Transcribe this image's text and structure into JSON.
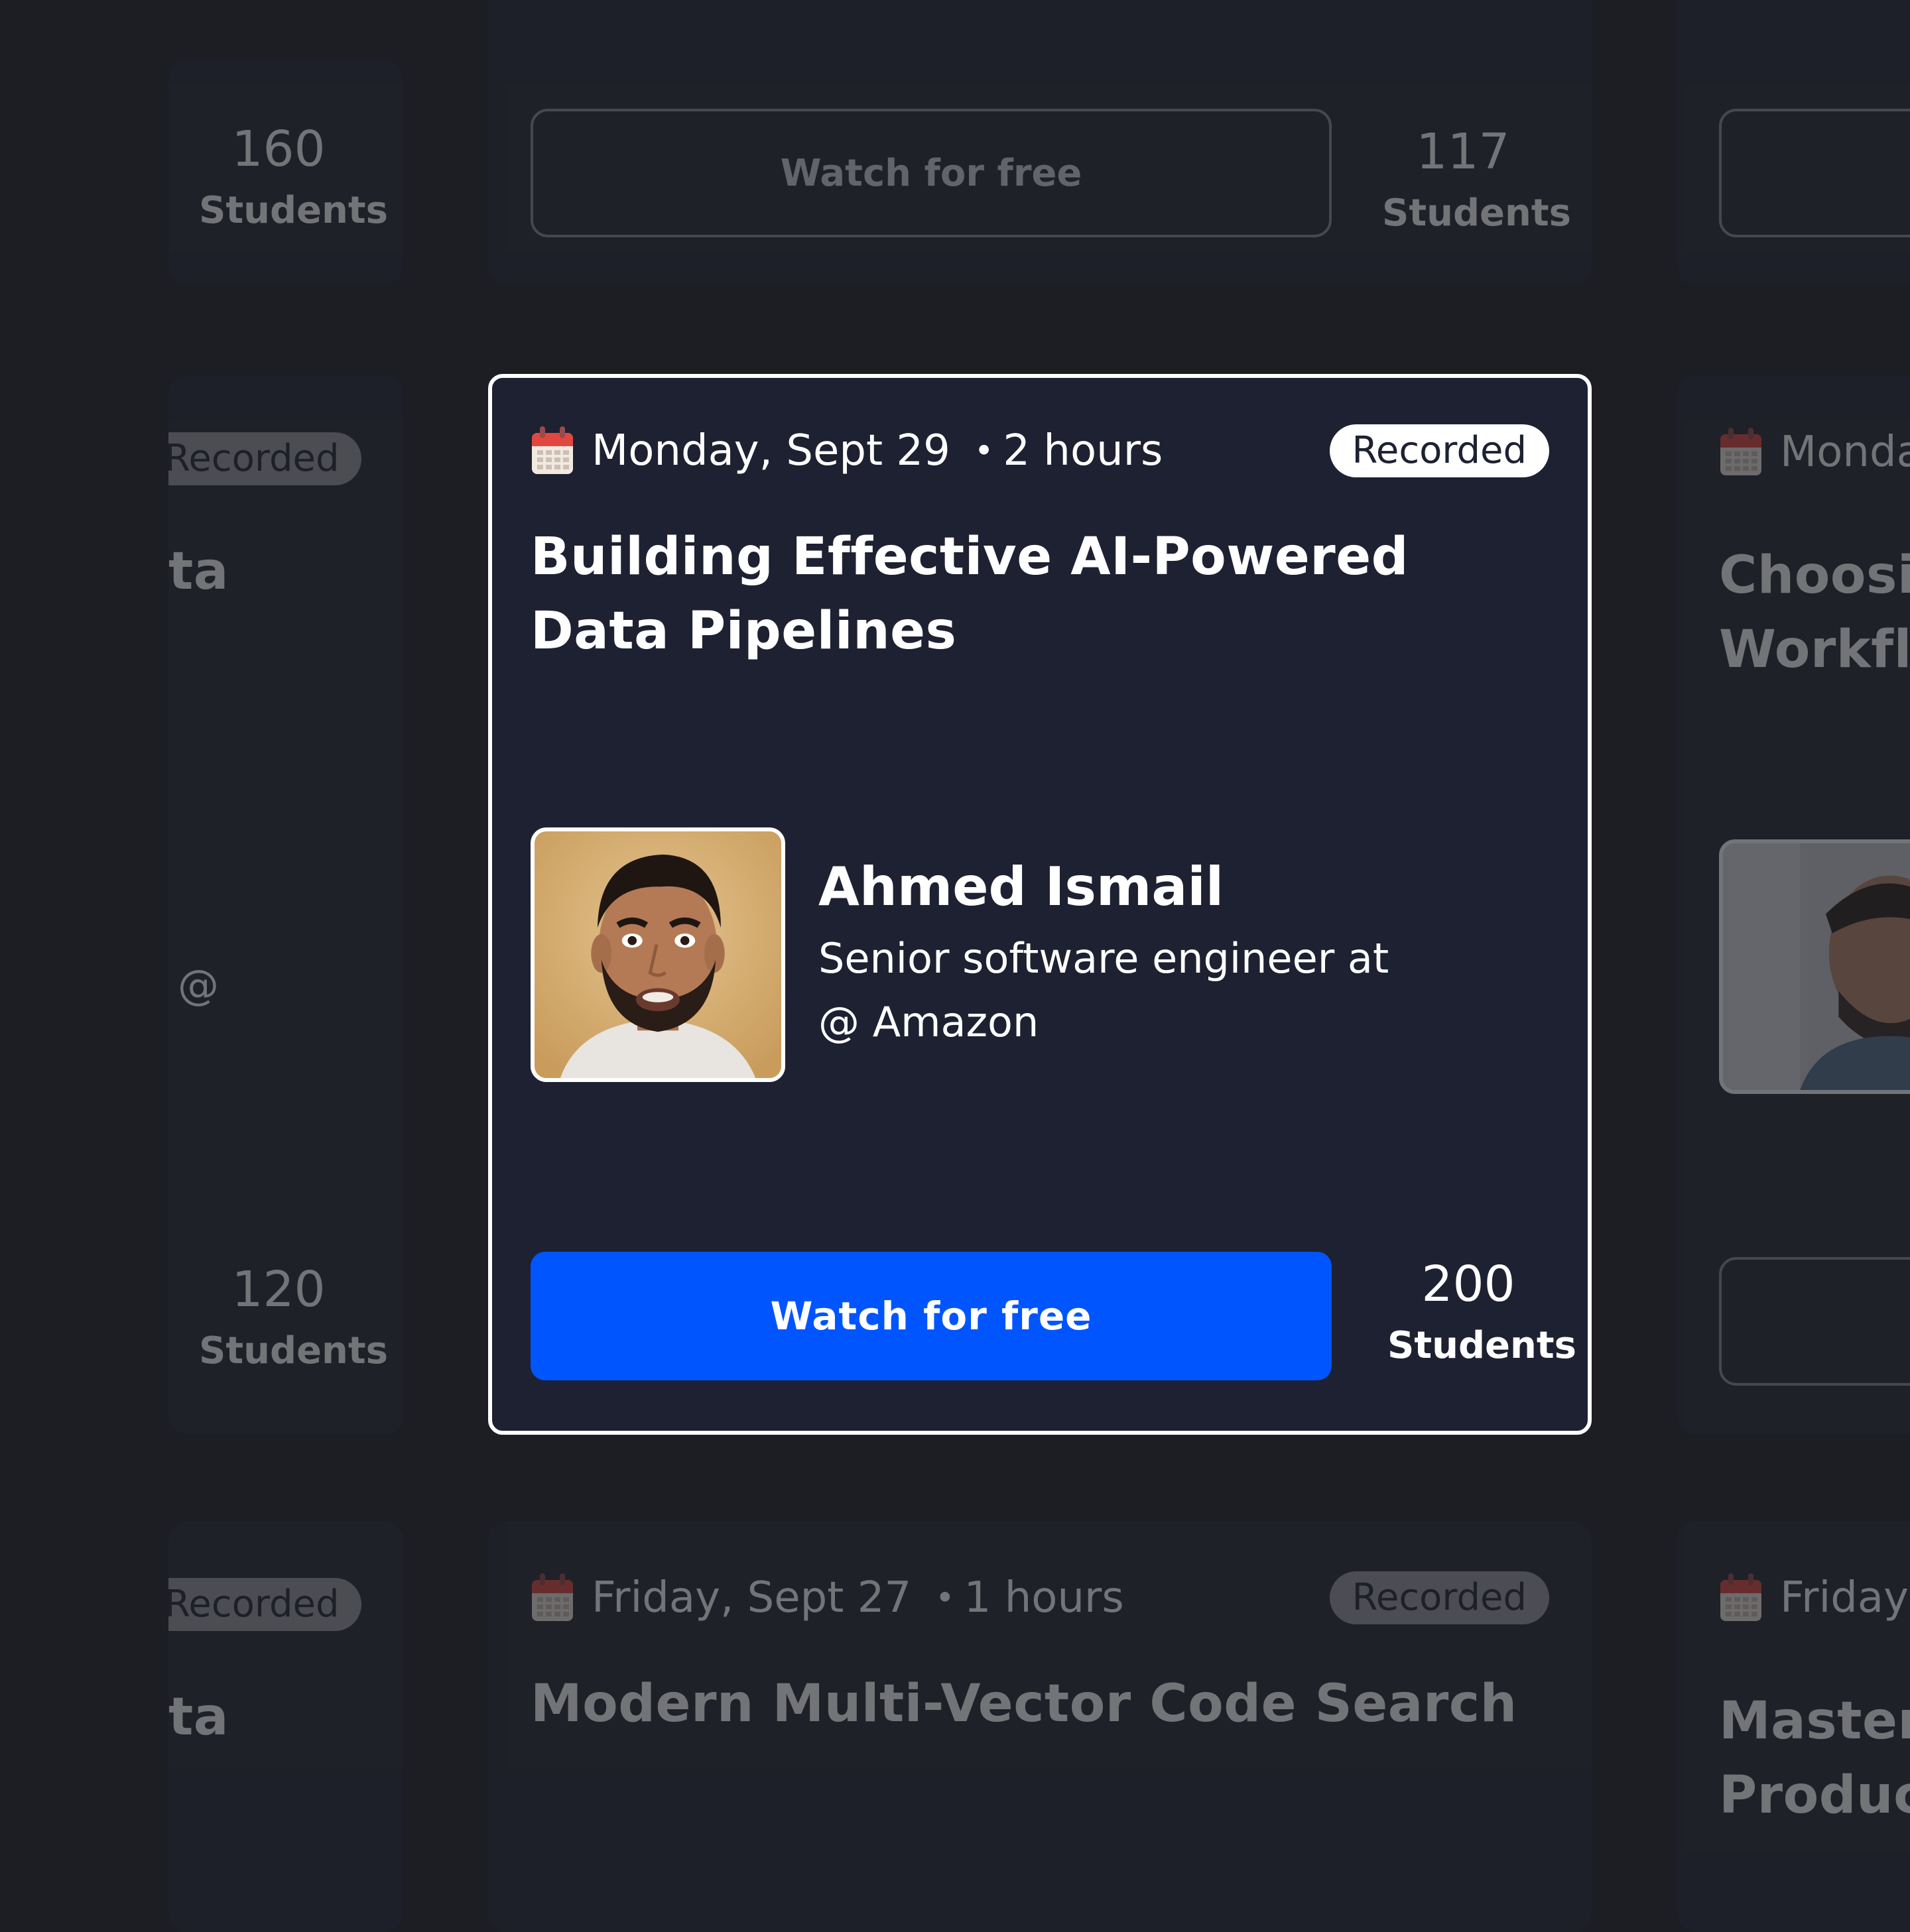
{
  "cards": {
    "top_center": {
      "button_label": "Watch for free",
      "students_count": "117",
      "students_label": "Students"
    },
    "top_left": {
      "students_count": "160",
      "students_label": "Students"
    },
    "middle_left": {
      "badge": "Recorded",
      "title_fragment": "ta",
      "role_fragment": "@",
      "students_count": "120",
      "students_label": "Students"
    },
    "main": {
      "date": "Monday, Sept 29",
      "dot": "•",
      "duration": "2 hours",
      "badge": "Recorded",
      "title": "Building Effective AI-Powered Data Pipelines",
      "speaker_name": "Ahmed Ismail",
      "speaker_role": "Senior software engineer at @ Amazon",
      "button_label": "Watch for free",
      "students_count": "200",
      "students_label": "Students"
    },
    "middle_right": {
      "date_fragment": "Monda",
      "title_line1": "Choosin",
      "title_line2": "Workflo"
    },
    "bottom_left": {
      "badge": "Recorded",
      "title_fragment": "ta"
    },
    "bottom_center": {
      "date": "Friday, Sept 27",
      "dot": "•",
      "duration": "1 hours",
      "badge": "Recorded",
      "title": "Modern Multi-Vector Code Search"
    },
    "bottom_right": {
      "date_fragment": "Friday,",
      "title_line1": "Master",
      "title_line2": "Product"
    }
  },
  "colors": {
    "background": "#1c1e24",
    "card": "#232631",
    "active_card": "#1d2131",
    "primary_button": "#0055ff",
    "badge_bg": "#ffffff"
  },
  "icons": {
    "calendar": "calendar-icon"
  }
}
